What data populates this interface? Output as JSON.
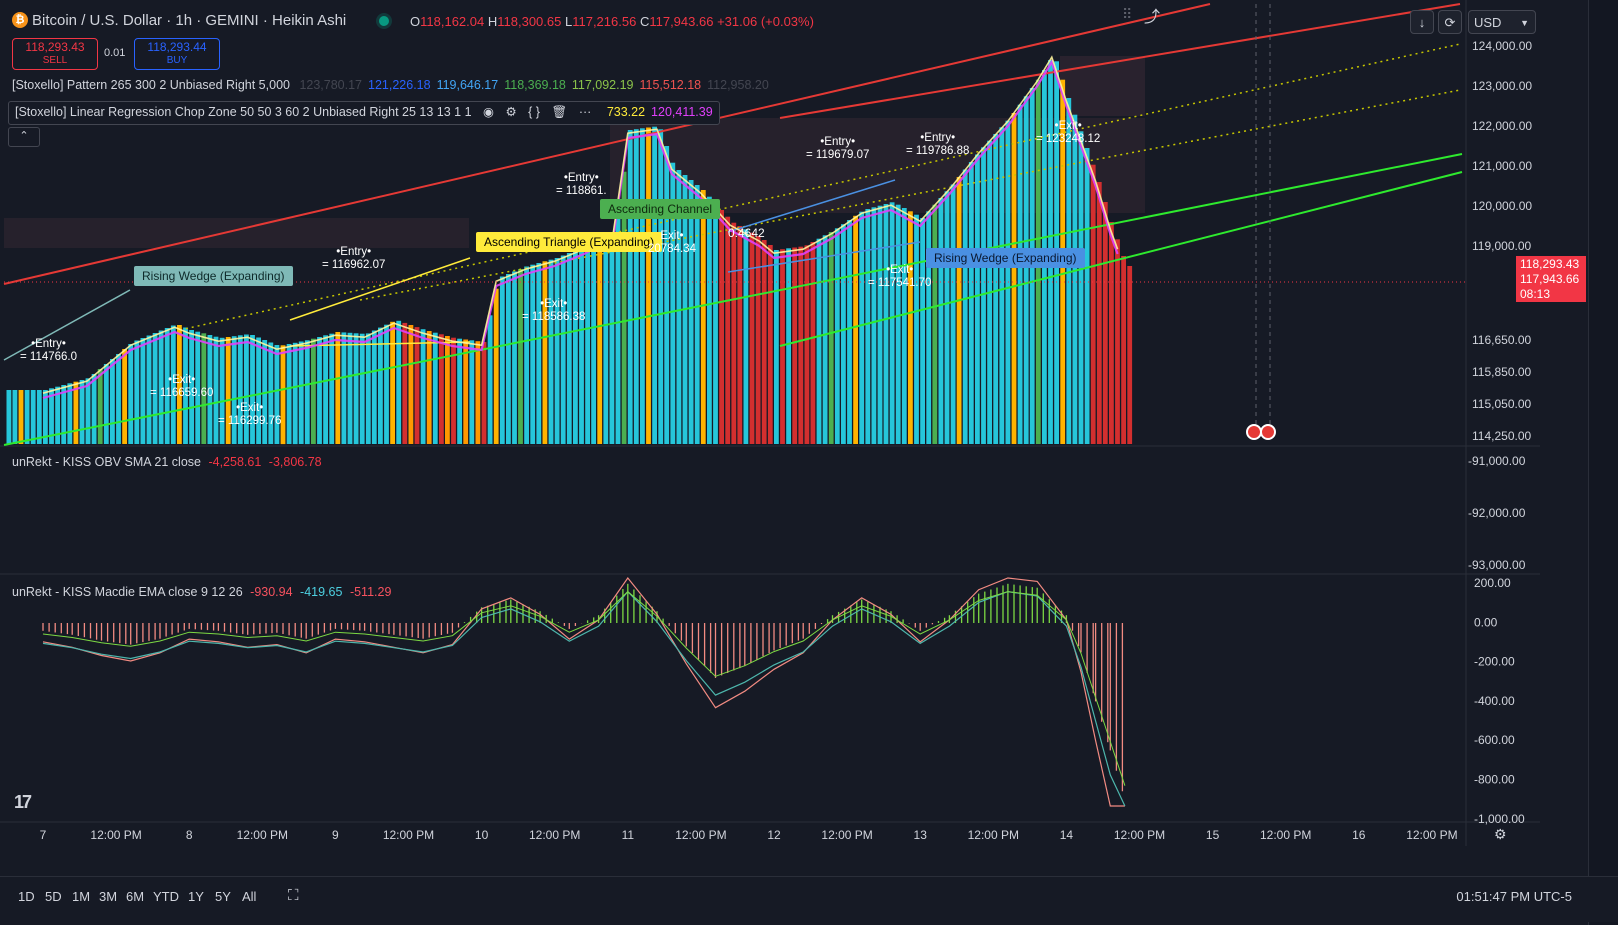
{
  "header": {
    "title": "Bitcoin / U.S. Dollar · 1h · GEMINI · Heikin Ashi",
    "open_label": "O",
    "open": "118,162.04",
    "high_label": "H",
    "high": "118,300.65",
    "low_label": "L",
    "low": "117,216.56",
    "close_label": "C",
    "close": "117,943.66",
    "change": "+31.06 (+0.03%)"
  },
  "trade": {
    "sell_price": "118,293.43",
    "sell_label": "SELL",
    "spread": "0.01",
    "buy_price": "118,293.44",
    "buy_label": "BUY"
  },
  "toolbar": {
    "currency": "USD"
  },
  "indicators": {
    "pattern": {
      "name": "[Stoxello] Pattern 265 300 2 Unbiased Right 5,000",
      "values": [
        "123,780.17",
        "121,226.18",
        "119,646.17",
        "118,369.18",
        "117,092.19",
        "115,512.18",
        "112,958.20"
      ],
      "colors": [
        "#434651",
        "#2962ff",
        "#42a5f5",
        "#4caf50",
        "#8bc34a",
        "#ef5350",
        "#434651"
      ]
    },
    "lr": {
      "name": "[Stoxello] Linear Regression Chop Zone 50 50 3 60 2 Unbiased Right 25 13 13 1 1",
      "values": [
        "733.22",
        "120,411.39"
      ],
      "colors": [
        "#ffeb3b",
        "#e040fb"
      ]
    },
    "obv": {
      "name": "unRekt - KISS OBV SMA 21 close",
      "values": [
        "-4,258.61",
        "-3,806.78"
      ]
    },
    "macd": {
      "name": "unRekt - KISS Macdie EMA close 9 12 26",
      "values": [
        "-930.94",
        "-419.65",
        "-511.29"
      ]
    }
  },
  "price_axis": {
    "main_ticks": [
      {
        "label": "124,000.00",
        "v": 124000
      },
      {
        "label": "123,000.00",
        "v": 123000
      },
      {
        "label": "122,000.00",
        "v": 122000
      },
      {
        "label": "121,000.00",
        "v": 121000
      },
      {
        "label": "120,000.00",
        "v": 120000
      },
      {
        "label": "119,000.00",
        "v": 119000
      },
      {
        "label": "116,650.00",
        "v": 116650
      },
      {
        "label": "115,850.00",
        "v": 115850
      },
      {
        "label": "115,050.00",
        "v": 115050
      },
      {
        "label": "114,250.00",
        "v": 114250
      }
    ],
    "current_price": "118,293.43",
    "current_close": "117,943.66",
    "countdown": "08:13",
    "obv_ticks": [
      "-91,000.00",
      "-92,000.00",
      "-93,000.00"
    ],
    "macd_ticks": [
      "200.00",
      "0.00",
      "-200.00",
      "-400.00",
      "-600.00",
      "-800.00",
      "-1,000.00"
    ]
  },
  "time_axis": [
    "7",
    "12:00 PM",
    "8",
    "12:00 PM",
    "9",
    "12:00 PM",
    "10",
    "12:00 PM",
    "11",
    "12:00 PM",
    "12",
    "12:00 PM",
    "13",
    "12:00 PM",
    "14",
    "12:00 PM",
    "15",
    "12:00 PM",
    "16",
    "12:00 PM"
  ],
  "annotations": [
    {
      "text": "•Entry•",
      "sub": "= 114766.0",
      "kind": "entry"
    },
    {
      "text": "•Entry•",
      "sub": "= 116962.07",
      "kind": "entry"
    },
    {
      "text": "•Entry•",
      "sub": "= 118861.",
      "kind": "entry"
    },
    {
      "text": "•Entry•",
      "sub": "= 119679.07",
      "kind": "entry"
    },
    {
      "text": "•Entry•",
      "sub": "= 119786.88",
      "kind": "entry"
    },
    {
      "text": "•Exit•",
      "sub": "= 116659.60",
      "kind": "exit"
    },
    {
      "text": "•Exit•",
      "sub": "= 116299.76",
      "kind": "exit"
    },
    {
      "text": "•Exit•",
      "sub": "= 118586.38",
      "kind": "exit"
    },
    {
      "text": "Exit•",
      "sub": "20784.34",
      "kind": "exit"
    },
    {
      "text": "•Exit•",
      "sub": "= 117541.70",
      "kind": "exit"
    },
    {
      "text": "•Exit•",
      "sub": "= 123248.12",
      "kind": "exit"
    }
  ],
  "patterns": [
    {
      "label": "Rising Wedge (Expanding)",
      "style": "teal"
    },
    {
      "label": "Ascending Triangle (Expanding)",
      "style": "yellow"
    },
    {
      "label": "Ascending Channel",
      "style": "green"
    },
    {
      "label": "Rising Wedge (Expanding)",
      "style": "blue"
    }
  ],
  "misc_labels": {
    "zero_label": "0.4642"
  },
  "range_buttons": [
    "1D",
    "5D",
    "1M",
    "3M",
    "6M",
    "YTD",
    "1Y",
    "5Y",
    "All"
  ],
  "clock": "01:51:47 PM UTC-5",
  "chart_data": {
    "type": "candlestick",
    "title": "Bitcoin / U.S. Dollar · 1h · GEMINI · Heikin Ashi",
    "xlabel": "",
    "ylabel": "",
    "ylim": [
      114000,
      124600
    ],
    "x_categories": [
      "7",
      "8",
      "9",
      "10",
      "11",
      "12",
      "13",
      "14",
      "15",
      "16"
    ],
    "series": [
      {
        "name": "",
        "close_path": [
          [
            7.0,
            115200
          ],
          [
            7.3,
            115500
          ],
          [
            7.6,
            116400
          ],
          [
            7.9,
            116850
          ],
          [
            8.0,
            116700
          ],
          [
            8.2,
            116500
          ],
          [
            8.4,
            116600
          ],
          [
            8.6,
            116300
          ],
          [
            8.8,
            116450
          ],
          [
            9.0,
            116650
          ],
          [
            9.2,
            116600
          ],
          [
            9.4,
            116950
          ],
          [
            9.6,
            116700
          ],
          [
            9.8,
            116500
          ],
          [
            10.0,
            116400
          ],
          [
            10.1,
            118000
          ],
          [
            10.3,
            118300
          ],
          [
            10.5,
            118500
          ],
          [
            10.7,
            118800
          ],
          [
            10.9,
            119200
          ],
          [
            11.0,
            121700
          ],
          [
            11.2,
            121800
          ],
          [
            11.3,
            120800
          ],
          [
            11.5,
            120200
          ],
          [
            11.7,
            119400
          ],
          [
            11.9,
            119000
          ],
          [
            12.0,
            118700
          ],
          [
            12.2,
            118800
          ],
          [
            12.4,
            119200
          ],
          [
            12.6,
            119700
          ],
          [
            12.8,
            119900
          ],
          [
            13.0,
            119500
          ],
          [
            13.2,
            120300
          ],
          [
            13.4,
            121200
          ],
          [
            13.6,
            122000
          ],
          [
            13.8,
            123000
          ],
          [
            13.9,
            123600
          ],
          [
            14.0,
            122500
          ],
          [
            14.1,
            121500
          ],
          [
            14.2,
            120500
          ],
          [
            14.3,
            119300
          ],
          [
            14.4,
            118300
          ]
        ]
      }
    ],
    "obv_ylim": [
      -93300,
      -90600
    ],
    "macd": {
      "ylim": [
        -1000,
        200
      ],
      "histogram": [
        [
          7.0,
          -40
        ],
        [
          7.2,
          -60
        ],
        [
          7.4,
          -90
        ],
        [
          7.6,
          -110
        ],
        [
          7.8,
          -80
        ],
        [
          8.0,
          -30
        ],
        [
          8.2,
          -40
        ],
        [
          8.4,
          -60
        ],
        [
          8.6,
          -50
        ],
        [
          8.8,
          -80
        ],
        [
          9.0,
          -30
        ],
        [
          9.2,
          -40
        ],
        [
          9.4,
          -60
        ],
        [
          9.6,
          -80
        ],
        [
          9.8,
          -50
        ],
        [
          10.0,
          80
        ],
        [
          10.2,
          120
        ],
        [
          10.4,
          60
        ],
        [
          10.6,
          -30
        ],
        [
          10.8,
          40
        ],
        [
          11.0,
          200
        ],
        [
          11.2,
          60
        ],
        [
          11.4,
          -120
        ],
        [
          11.6,
          -280
        ],
        [
          11.8,
          -220
        ],
        [
          12.0,
          -140
        ],
        [
          12.2,
          -80
        ],
        [
          12.4,
          40
        ],
        [
          12.6,
          120
        ],
        [
          12.8,
          60
        ],
        [
          13.0,
          -40
        ],
        [
          13.2,
          40
        ],
        [
          13.4,
          150
        ],
        [
          13.6,
          200
        ],
        [
          13.8,
          180
        ],
        [
          14.0,
          40
        ],
        [
          14.1,
          -150
        ],
        [
          14.2,
          -400
        ],
        [
          14.3,
          -650
        ],
        [
          14.4,
          -900
        ]
      ]
    }
  }
}
